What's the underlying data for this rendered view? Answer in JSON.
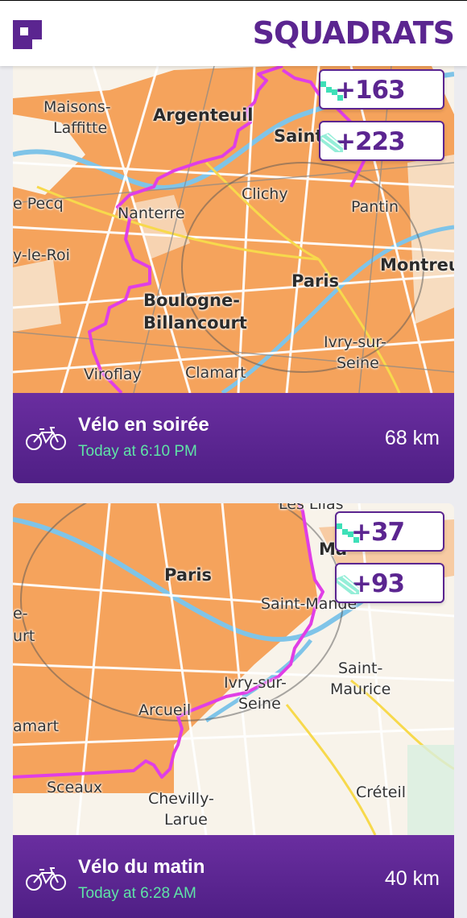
{
  "header": {
    "brand": "SQUADRATS",
    "logo_icon": "squadrats-logo-icon"
  },
  "colors": {
    "accent": "#5b2590",
    "route": "#e03ee6",
    "tile_fill": "#f5a35c",
    "time_green": "#5fe3a7"
  },
  "activities": [
    {
      "title": "Vélo en soirée",
      "time": "Today at 6:10 PM",
      "distance": "68 km",
      "badges": [
        {
          "value": "+163",
          "icon": "squadratinhos-icon"
        },
        {
          "value": "+223",
          "icon": "squadrats-icon"
        }
      ],
      "map_labels": [
        "Maisons-",
        "Laffitte",
        "Argenteuil",
        "Saint",
        "e Pecq",
        "Nanterre",
        "Clichy",
        "Pantin",
        "y-le-Roi",
        "Montreu",
        "Paris",
        "Boulogne-",
        "Billancourt",
        "Ivry-sur-",
        "Seine",
        "Viroflay",
        "Clamart"
      ]
    },
    {
      "title": "Vélo du matin",
      "time": "Today at 6:28 AM",
      "distance": "40 km",
      "badges": [
        {
          "value": "+37",
          "icon": "squadratinhos-icon"
        },
        {
          "value": "+93",
          "icon": "squadrats-icon"
        }
      ],
      "map_labels": [
        "Les Lilas",
        "Paris",
        "Ma",
        "Saint-Mande",
        "e-",
        "urt",
        "Saint-",
        "Maurice",
        "Ivry-sur-",
        "Seine",
        "Arcueil",
        "amart",
        "Sceaux",
        "Chevilly-",
        "Larue",
        "Créteil"
      ]
    }
  ]
}
